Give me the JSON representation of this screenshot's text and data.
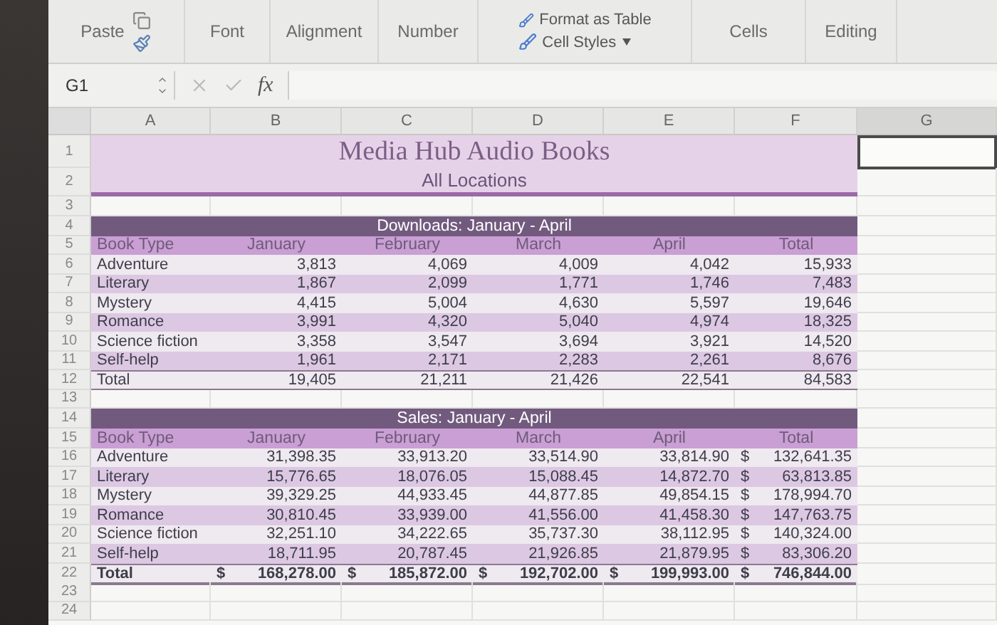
{
  "ribbon": {
    "groups": [
      {
        "kind": "paste",
        "label": "Paste"
      },
      {
        "kind": "plain",
        "label": "Font"
      },
      {
        "kind": "plain",
        "label": "Alignment"
      },
      {
        "kind": "plain",
        "label": "Number"
      },
      {
        "kind": "styles",
        "label": "Format as Table",
        "sublabel": "Cell Styles"
      },
      {
        "kind": "plain",
        "label": "Cells"
      },
      {
        "kind": "plain",
        "label": "Editing"
      }
    ]
  },
  "formula_bar": {
    "name_box": "G1",
    "function_label": "fx"
  },
  "columns": [
    {
      "label": "A",
      "selected": false
    },
    {
      "label": "B",
      "selected": false
    },
    {
      "label": "C",
      "selected": false
    },
    {
      "label": "D",
      "selected": false
    },
    {
      "label": "E",
      "selected": false
    },
    {
      "label": "F",
      "selected": false
    },
    {
      "label": "G",
      "selected": true
    }
  ],
  "rows": [
    {
      "number": "1",
      "kind": "title",
      "text": "Media Hub Audio Books"
    },
    {
      "number": "2",
      "kind": "subtitle",
      "text": "All Locations"
    },
    {
      "number": "3",
      "kind": "blank"
    },
    {
      "number": "4",
      "kind": "band",
      "text": "Downloads: January - April"
    },
    {
      "number": "5",
      "kind": "header",
      "cells": [
        "Book Type",
        "January",
        "February",
        "March",
        "April",
        "Total"
      ]
    },
    {
      "number": "6",
      "kind": "data",
      "shaded": false,
      "cells": [
        "Adventure",
        "3,813",
        "4,069",
        "4,009",
        "4,042",
        "15,933"
      ]
    },
    {
      "number": "7",
      "kind": "data",
      "shaded": true,
      "cells": [
        "Literary",
        "1,867",
        "2,099",
        "1,771",
        "1,746",
        "7,483"
      ]
    },
    {
      "number": "8",
      "kind": "data",
      "shaded": false,
      "cells": [
        "Mystery",
        "4,415",
        "5,004",
        "4,630",
        "5,597",
        "19,646"
      ]
    },
    {
      "number": "9",
      "kind": "data",
      "shaded": true,
      "cells": [
        "Romance",
        "3,991",
        "4,320",
        "5,040",
        "4,974",
        "18,325"
      ]
    },
    {
      "number": "10",
      "kind": "data",
      "shaded": false,
      "cells": [
        "Science fiction",
        "3,358",
        "3,547",
        "3,694",
        "3,921",
        "14,520"
      ]
    },
    {
      "number": "11",
      "kind": "data",
      "shaded": true,
      "cells": [
        "Self-help",
        "1,961",
        "2,171",
        "2,283",
        "2,261",
        "8,676"
      ]
    },
    {
      "number": "12",
      "kind": "total",
      "bold": false,
      "cells": [
        "Total",
        "19,405",
        "21,211",
        "21,426",
        "22,541",
        "84,583"
      ]
    },
    {
      "number": "13",
      "kind": "blank"
    },
    {
      "number": "14",
      "kind": "band",
      "text": "Sales: January - April"
    },
    {
      "number": "15",
      "kind": "header",
      "cells": [
        "Book Type",
        "January",
        "February",
        "March",
        "April",
        "Total"
      ]
    },
    {
      "number": "16",
      "kind": "data",
      "shaded": false,
      "cells": [
        "Adventure",
        "31,398.35",
        "33,913.20",
        "33,514.90",
        "33,814.90",
        {
          "symbol": "$",
          "text": "132,641.35"
        }
      ]
    },
    {
      "number": "17",
      "kind": "data",
      "shaded": true,
      "cells": [
        "Literary",
        "15,776.65",
        "18,076.05",
        "15,088.45",
        "14,872.70",
        {
          "symbol": "$",
          "text": "63,813.85"
        }
      ]
    },
    {
      "number": "18",
      "kind": "data",
      "shaded": false,
      "cells": [
        "Mystery",
        "39,329.25",
        "44,933.45",
        "44,877.85",
        "49,854.15",
        {
          "symbol": "$",
          "text": "178,994.70"
        }
      ]
    },
    {
      "number": "19",
      "kind": "data",
      "shaded": true,
      "cells": [
        "Romance",
        "30,810.45",
        "33,939.00",
        "41,556.00",
        "41,458.30",
        {
          "symbol": "$",
          "text": "147,763.75"
        }
      ]
    },
    {
      "number": "20",
      "kind": "data",
      "shaded": false,
      "cells": [
        "Science fiction",
        "32,251.10",
        "34,222.65",
        "35,737.30",
        "38,112.95",
        {
          "symbol": "$",
          "text": "140,324.00"
        }
      ]
    },
    {
      "number": "21",
      "kind": "data",
      "shaded": true,
      "cells": [
        "Self-help",
        "18,711.95",
        "20,787.45",
        "21,926.85",
        "21,879.95",
        {
          "symbol": "$",
          "text": "83,306.20"
        }
      ]
    },
    {
      "number": "22",
      "kind": "total",
      "bold": true,
      "cells": [
        "Total",
        {
          "symbol": "$",
          "text": "168,278.00"
        },
        {
          "symbol": "$",
          "text": "185,872.00"
        },
        {
          "symbol": "$",
          "text": "192,702.00"
        },
        {
          "symbol": "$",
          "text": "199,993.00"
        },
        {
          "symbol": "$",
          "text": "746,844.00"
        }
      ]
    },
    {
      "number": "23",
      "kind": "blank"
    },
    {
      "number": "24",
      "kind": "blank"
    }
  ]
}
